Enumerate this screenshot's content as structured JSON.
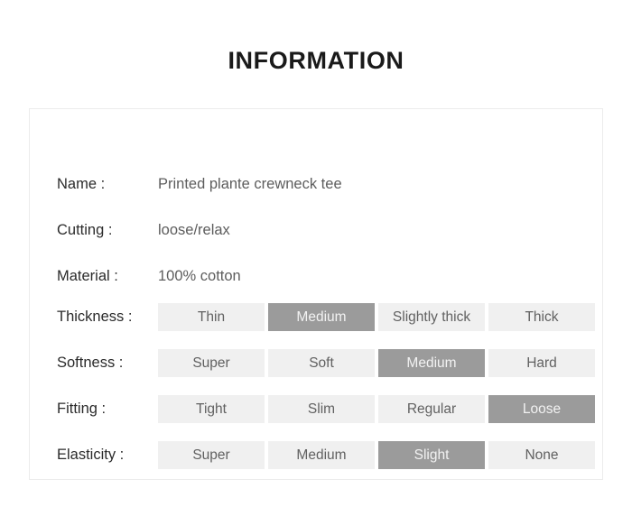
{
  "page": {
    "title": "INFORMATION",
    "background_color": "#ffffff",
    "card_border_color": "#ececec",
    "label_color": "#2b2b2b",
    "value_color": "#5d5d5d",
    "cell_color": "#f0f0f0",
    "cell_selected_color": "#9b9b9b",
    "cell_selected_text_color": "#f2f2f2"
  },
  "text_rows": [
    {
      "label": "Name :",
      "value": "Printed plante crewneck tee"
    },
    {
      "label": "Cutting :",
      "value": "loose/relax"
    },
    {
      "label": "Material :",
      "value": "100% cotton"
    }
  ],
  "option_rows": [
    {
      "label": "Thickness :",
      "options": [
        {
          "text": "Thin",
          "selected": false
        },
        {
          "text": "Medium",
          "selected": true
        },
        {
          "text": "Slightly thick",
          "selected": false
        },
        {
          "text": "Thick",
          "selected": false
        }
      ]
    },
    {
      "label": "Softness :",
      "options": [
        {
          "text": "Super",
          "selected": false
        },
        {
          "text": "Soft",
          "selected": false
        },
        {
          "text": "Medium",
          "selected": true
        },
        {
          "text": "Hard",
          "selected": false
        }
      ]
    },
    {
      "label": "Fitting :",
      "options": [
        {
          "text": "Tight",
          "selected": false
        },
        {
          "text": "Slim",
          "selected": false
        },
        {
          "text": "Regular",
          "selected": false
        },
        {
          "text": "Loose",
          "selected": true
        }
      ]
    },
    {
      "label": "Elasticity :",
      "options": [
        {
          "text": "Super",
          "selected": false
        },
        {
          "text": "Medium",
          "selected": false
        },
        {
          "text": "Slight",
          "selected": true
        },
        {
          "text": "None",
          "selected": false
        }
      ]
    }
  ]
}
